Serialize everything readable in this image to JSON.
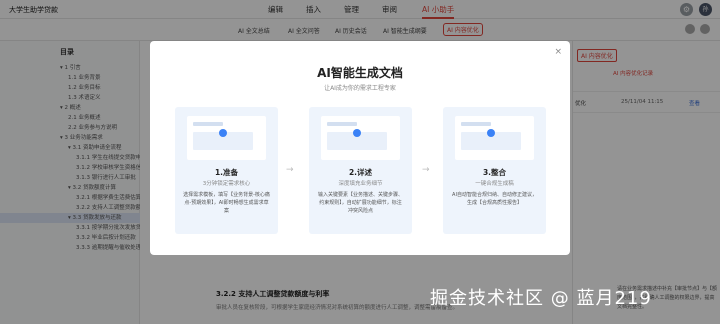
{
  "header": {
    "doc_title": "大学生助学贷款",
    "menus": [
      "编辑",
      "插入",
      "管理",
      "审阅",
      "AI 小助手"
    ],
    "active_menu": "AI 小助手",
    "avatar_text": "孙"
  },
  "toolbar": {
    "items": [
      "AI 全文总结",
      "AI 全文问答",
      "AI 历史会话",
      "AI 智能生成纲要",
      "AI 内容优化"
    ],
    "highlighted": "AI 内容优化"
  },
  "sidebar": {
    "title": "目录",
    "items": [
      {
        "label": "▾ 1 引言",
        "level": 1
      },
      {
        "label": "1.1 业务背景",
        "level": 2
      },
      {
        "label": "1.2 业务目标",
        "level": 2
      },
      {
        "label": "1.3 术语定义",
        "level": 2
      },
      {
        "label": "▾ 2 概述",
        "level": 1
      },
      {
        "label": "2.1 业务概述",
        "level": 2
      },
      {
        "label": "2.2 业务参与方说明",
        "level": 2
      },
      {
        "label": "▾ 3 业务功能需求",
        "level": 1
      },
      {
        "label": "▾ 3.1 资助申请全流程",
        "level": 2
      },
      {
        "label": "3.1.1 学生在线提交贷款申请",
        "level": 3
      },
      {
        "label": "3.1.2 学校审核学生资格信息",
        "level": 3
      },
      {
        "label": "3.1.3 银行进行人工审批",
        "level": 3
      },
      {
        "label": "▾ 3.2 贷款额度计算",
        "level": 2
      },
      {
        "label": "3.2.1 根据学费生活费估算额度",
        "level": 3
      },
      {
        "label": "3.2.2 支持人工调整贷款额度",
        "level": 3
      },
      {
        "label": "▾ 3.3 贷款发放与还款",
        "level": 2
      },
      {
        "label": "3.3.1 按学期分批次发放贷款",
        "level": 3
      },
      {
        "label": "3.3.2 毕业后按计划还款",
        "level": 3
      },
      {
        "label": "3.3.3 逾期提醒与催收处理",
        "level": 3
      }
    ],
    "active_index": 15
  },
  "document": {
    "heading": "3.2.2 支持人工调整贷款额度与利率",
    "line": "审批人员在复核阶段，可根据学生家庭经济情况对系统初算的额度进行人工调整，调整需留痕备查。"
  },
  "right_panel": {
    "tab": "AI 内容优化",
    "subtitle": "AI 内容优化记录",
    "row_name": "优化",
    "row_time": "25/11/04 11:15",
    "row_link": "查看",
    "note": "请在业务需求描述中补充【审批节点】与【额度范围】，并明确人工调整的权限边界，提高文档完整性。"
  },
  "modal": {
    "title": "AI智能生成文档",
    "subtitle": "让AI成为你的需求工程专家",
    "close_label": "×",
    "cards": [
      {
        "title": "1.准备",
        "sub": "3分钟锁定需求核心",
        "desc": "选择需求模板，填写【业务背景-核心痛点-预期效果】，AI即时畅想生成需求草案"
      },
      {
        "title": "2.详述",
        "sub": "深度填充业务细节",
        "desc": "输入关键要素【业务描述、关键步骤、约束规则】，自动扩展功能细节，标注冲突风险点"
      },
      {
        "title": "3.整合",
        "sub": "一键合规生成稿",
        "desc": "AI自动智能合规归纳、自动修正建议，生成【合规高质性报告】"
      }
    ],
    "arrow": "→"
  },
  "watermark": "掘金技术社区 @ 蓝月219",
  "colors": {
    "accent": "#e0453c",
    "card_bg": "#eef4fc",
    "link": "#3b6fd8"
  }
}
